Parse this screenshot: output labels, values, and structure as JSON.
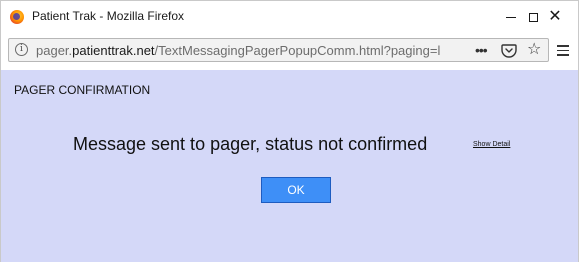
{
  "window": {
    "title": "Patient Trak - Mozilla Firefox",
    "app_icon": "firefox-icon",
    "controls": {
      "minimize": "—",
      "maximize": "☐",
      "close": "✕"
    }
  },
  "navbar": {
    "url_prefix": "pager.",
    "url_domain": "patienttrak.net",
    "url_path": "/TextMessagingPagerPopupComm.html?paging=l",
    "icons": [
      "info-icon",
      "more-icon",
      "pocket-icon",
      "star-icon",
      "menu-icon"
    ],
    "more_glyph": "•••",
    "star_glyph": "☆",
    "info_glyph": "i"
  },
  "page": {
    "background": "#d4d8f8",
    "heading": "PAGER CONFIRMATION",
    "message": "Message sent to pager, status not confirmed",
    "detail_link": "Show Detail",
    "ok_label": "OK",
    "ok_color": "#3e8ff7"
  }
}
